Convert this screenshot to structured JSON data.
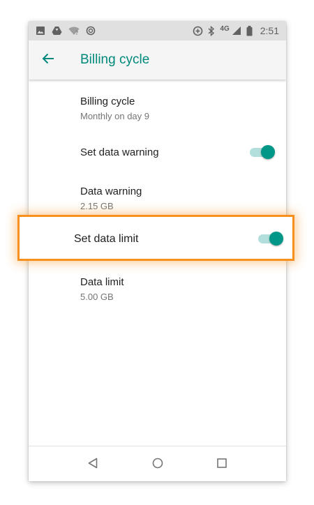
{
  "status_bar": {
    "network": "4G",
    "time": "2:51",
    "icons_left": [
      "image-icon",
      "drive-icon",
      "wifi-question-icon",
      "sync-icon"
    ],
    "icons_right": [
      "data-saver-icon",
      "bluetooth-icon",
      "signal-icon",
      "battery-icon"
    ]
  },
  "app_bar": {
    "title": "Billing cycle",
    "back_icon": "arrow-back-icon"
  },
  "settings": {
    "billing_cycle": {
      "title": "Billing cycle",
      "subtitle": "Monthly on day 9"
    },
    "set_data_warning": {
      "title": "Set data warning",
      "enabled": true
    },
    "data_warning": {
      "title": "Data warning",
      "subtitle": "2.15 GB"
    },
    "set_data_limit": {
      "title": "Set data limit",
      "enabled": true
    },
    "data_limit": {
      "title": "Data limit",
      "subtitle": "5.00 GB"
    }
  },
  "nav_bar": {
    "icons": [
      "back-triangle-icon",
      "home-circle-icon",
      "recents-square-icon"
    ]
  },
  "colors": {
    "accent": "#009688",
    "title_teal": "#00897b",
    "highlight": "#f7901e",
    "track": "#b2dfdb"
  }
}
